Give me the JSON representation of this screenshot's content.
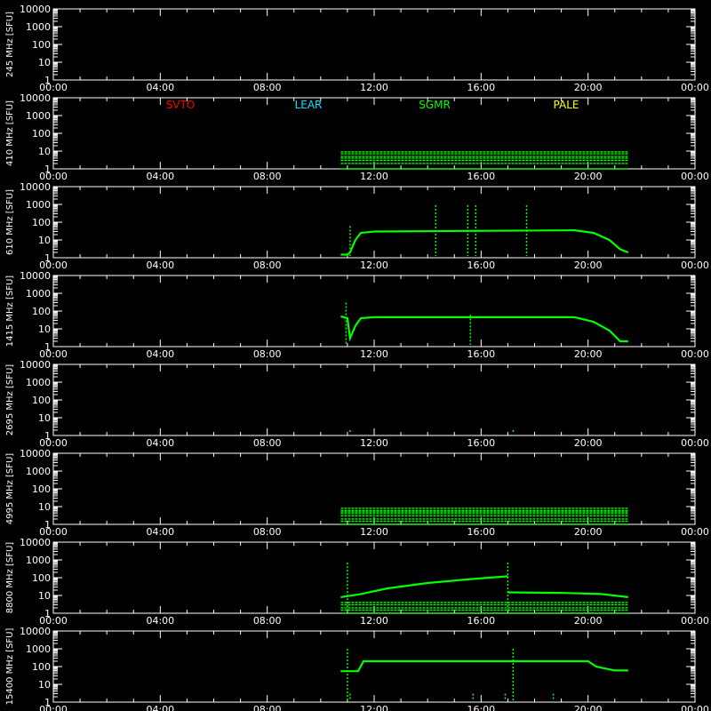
{
  "chart_data": [
    {
      "type": "scatter",
      "ylabel": "245 MHz [SFU]",
      "yscale": "log",
      "ylim": [
        1,
        10000
      ],
      "xlim": [
        0,
        24
      ],
      "x_ticks": [
        "00:00",
        "04:00",
        "08:00",
        "12:00",
        "16:00",
        "20:00",
        "00:00"
      ],
      "y_ticks": [
        "1",
        "10",
        "100",
        "1000",
        "10000"
      ],
      "series": [
        {
          "color": "#00ff00",
          "segments": [],
          "bursts": [],
          "bands": []
        }
      ]
    },
    {
      "type": "scatter",
      "ylabel": "410 MHz [SFU]",
      "yscale": "log",
      "ylim": [
        1,
        10000
      ],
      "xlim": [
        0,
        24
      ],
      "x_ticks": [
        "00:00",
        "04:00",
        "08:00",
        "12:00",
        "16:00",
        "20:00",
        "00:00"
      ],
      "y_ticks": [
        "1",
        "10",
        "100",
        "1000",
        "10000"
      ],
      "series": [
        {
          "color": "#00ff00",
          "segments": [],
          "bursts": [],
          "bands": [
            {
              "x": [
                10.75,
                21.5
              ],
              "y": [
                1,
                2,
                3,
                4,
                5,
                7,
                9
              ]
            }
          ]
        }
      ]
    },
    {
      "type": "scatter",
      "ylabel": "610 MHz [SFU]",
      "yscale": "log",
      "ylim": [
        1,
        10000
      ],
      "xlim": [
        0,
        24
      ],
      "x_ticks": [
        "00:00",
        "04:00",
        "08:00",
        "12:00",
        "16:00",
        "20:00",
        "00:00"
      ],
      "y_ticks": [
        "1",
        "10",
        "100",
        "1000",
        "10000"
      ],
      "series": [
        {
          "color": "#00ff00",
          "segments": [
            [
              [
                10.75,
                1.5
              ],
              [
                11.0,
                1.5
              ],
              [
                11.1,
                2
              ],
              [
                11.3,
                10
              ],
              [
                11.5,
                25
              ],
              [
                12.0,
                30
              ],
              [
                19.5,
                35
              ],
              [
                20.2,
                25
              ],
              [
                20.8,
                10
              ],
              [
                21.2,
                3
              ],
              [
                21.5,
                2
              ]
            ]
          ],
          "bursts": [
            [
              11.1,
              60
            ],
            [
              14.3,
              900
            ],
            [
              15.5,
              900
            ],
            [
              15.8,
              900
            ],
            [
              17.7,
              900
            ]
          ],
          "bands": []
        }
      ]
    },
    {
      "type": "scatter",
      "ylabel": "1415 MHz [SFU]",
      "yscale": "log",
      "ylim": [
        1,
        10000
      ],
      "xlim": [
        0,
        24
      ],
      "x_ticks": [
        "00:00",
        "04:00",
        "08:00",
        "12:00",
        "16:00",
        "20:00",
        "00:00"
      ],
      "y_ticks": [
        "1",
        "10",
        "100",
        "1000",
        "10000"
      ],
      "series": [
        {
          "color": "#00ff00",
          "segments": [
            [
              [
                10.75,
                50
              ],
              [
                11.0,
                40
              ],
              [
                11.1,
                3
              ],
              [
                11.3,
                15
              ],
              [
                11.5,
                40
              ],
              [
                12.0,
                45
              ],
              [
                19.5,
                45
              ],
              [
                20.2,
                25
              ],
              [
                20.8,
                8
              ],
              [
                21.2,
                2
              ],
              [
                21.5,
                2
              ]
            ]
          ],
          "bursts": [
            [
              10.95,
              300
            ],
            [
              15.6,
              60
            ]
          ],
          "bands": []
        }
      ]
    },
    {
      "type": "scatter",
      "ylabel": "2695 MHz [SFU]",
      "yscale": "log",
      "ylim": [
        1,
        10000
      ],
      "xlim": [
        0,
        24
      ],
      "x_ticks": [
        "00:00",
        "04:00",
        "08:00",
        "12:00",
        "16:00",
        "20:00",
        "00:00"
      ],
      "y_ticks": [
        "1",
        "10",
        "100",
        "1000",
        "10000"
      ],
      "series": [
        {
          "color": "#00ff00",
          "segments": [],
          "bursts": [
            [
              11.1,
              2
            ],
            [
              17.2,
              2
            ]
          ],
          "bands": []
        }
      ]
    },
    {
      "type": "scatter",
      "ylabel": "4995 MHz [SFU]",
      "yscale": "log",
      "ylim": [
        1,
        10000
      ],
      "xlim": [
        0,
        24
      ],
      "x_ticks": [
        "00:00",
        "04:00",
        "08:00",
        "12:00",
        "16:00",
        "20:00",
        "00:00"
      ],
      "y_ticks": [
        "1",
        "10",
        "100",
        "1000",
        "10000"
      ],
      "series": [
        {
          "color": "#00ff00",
          "segments": [],
          "bursts": [],
          "bands": [
            {
              "x": [
                10.75,
                21.5
              ],
              "y": [
                1,
                1.5,
                2,
                3,
                4,
                5,
                6,
                8
              ]
            }
          ]
        }
      ]
    },
    {
      "type": "scatter",
      "ylabel": "8800 MHz [SFU]",
      "yscale": "log",
      "ylim": [
        1,
        10000
      ],
      "xlim": [
        0,
        24
      ],
      "x_ticks": [
        "00:00",
        "04:00",
        "08:00",
        "12:00",
        "16:00",
        "20:00",
        "00:00"
      ],
      "y_ticks": [
        "1",
        "10",
        "100",
        "1000",
        "10000"
      ],
      "series": [
        {
          "color": "#00ff00",
          "segments": [
            [
              [
                10.75,
                8
              ],
              [
                11.5,
                12
              ],
              [
                12.5,
                25
              ],
              [
                14.0,
                50
              ],
              [
                15.5,
                80
              ],
              [
                17.0,
                120
              ]
            ],
            [
              [
                17.0,
                15
              ],
              [
                19.0,
                14
              ],
              [
                20.5,
                12
              ],
              [
                21.5,
                8
              ]
            ]
          ],
          "bursts": [
            [
              11.0,
              700
            ],
            [
              17.0,
              700
            ]
          ],
          "bands": [
            {
              "x": [
                10.75,
                21.5
              ],
              "y": [
                1,
                1.5,
                2,
                3,
                4
              ]
            }
          ]
        }
      ]
    },
    {
      "type": "scatter",
      "ylabel": "15400 MHz [SFU]",
      "yscale": "log",
      "ylim": [
        1,
        10000
      ],
      "xlim": [
        0,
        24
      ],
      "x_ticks": [
        "00:00",
        "04:00",
        "08:00",
        "12:00",
        "16:00",
        "20:00",
        "00:00"
      ],
      "y_ticks": [
        "1",
        "10",
        "100",
        "1000",
        "10000"
      ],
      "series": [
        {
          "color": "#00ff00",
          "segments": [
            [
              [
                10.75,
                55
              ],
              [
                11.4,
                55
              ],
              [
                11.6,
                200
              ],
              [
                20.0,
                200
              ],
              [
                20.3,
                100
              ],
              [
                20.6,
                80
              ],
              [
                21.0,
                60
              ],
              [
                21.5,
                60
              ]
            ]
          ],
          "bursts": [
            [
              11.0,
              1000
            ],
            [
              11.1,
              3
            ],
            [
              15.7,
              3
            ],
            [
              16.9,
              3
            ],
            [
              17.2,
              1000
            ],
            [
              18.7,
              3
            ]
          ],
          "bands": []
        }
      ]
    }
  ],
  "legend": [
    {
      "label": "SVTO",
      "color": "#ff0000"
    },
    {
      "label": "LEAR",
      "color": "#00e5ff"
    },
    {
      "label": "SGMR",
      "color": "#00ff00"
    },
    {
      "label": "PALE",
      "color": "#ffff00"
    }
  ]
}
